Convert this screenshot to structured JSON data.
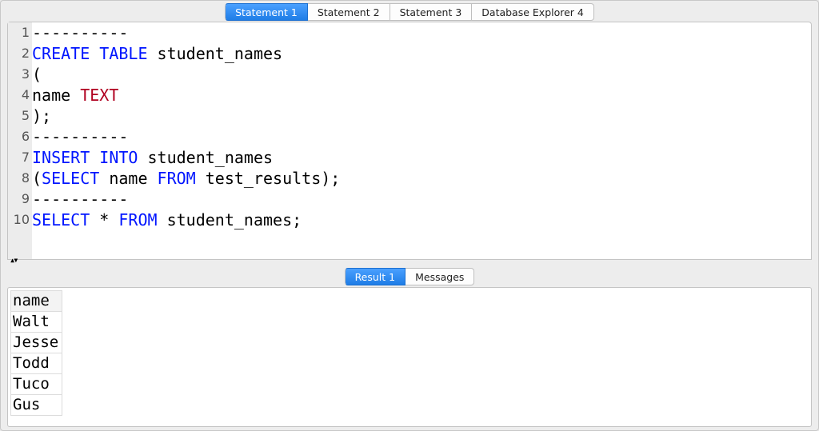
{
  "topTabs": [
    {
      "label": "Statement 1",
      "active": true
    },
    {
      "label": "Statement 2",
      "active": false
    },
    {
      "label": "Statement 3",
      "active": false
    },
    {
      "label": "Database Explorer 4",
      "active": false
    }
  ],
  "editor": {
    "lines": [
      [
        {
          "t": "txt",
          "v": "----------"
        }
      ],
      [
        {
          "t": "kw",
          "v": "CREATE"
        },
        {
          "t": "txt",
          "v": " "
        },
        {
          "t": "kw",
          "v": "TABLE"
        },
        {
          "t": "txt",
          "v": " student_names"
        }
      ],
      [
        {
          "t": "txt",
          "v": "("
        }
      ],
      [
        {
          "t": "txt",
          "v": "name "
        },
        {
          "t": "type",
          "v": "TEXT"
        }
      ],
      [
        {
          "t": "txt",
          "v": ");"
        }
      ],
      [
        {
          "t": "txt",
          "v": "----------"
        }
      ],
      [
        {
          "t": "kw",
          "v": "INSERT"
        },
        {
          "t": "txt",
          "v": " "
        },
        {
          "t": "kw",
          "v": "INTO"
        },
        {
          "t": "txt",
          "v": " student_names"
        }
      ],
      [
        {
          "t": "txt",
          "v": "("
        },
        {
          "t": "kw",
          "v": "SELECT"
        },
        {
          "t": "txt",
          "v": " name "
        },
        {
          "t": "kw",
          "v": "FROM"
        },
        {
          "t": "txt",
          "v": " test_results);"
        }
      ],
      [
        {
          "t": "txt",
          "v": "----------"
        }
      ],
      [
        {
          "t": "kw",
          "v": "SELECT"
        },
        {
          "t": "txt",
          "v": " * "
        },
        {
          "t": "kw",
          "v": "FROM"
        },
        {
          "t": "txt",
          "v": " student_names;"
        }
      ]
    ]
  },
  "resultTabs": [
    {
      "label": "Result 1",
      "active": true
    },
    {
      "label": "Messages",
      "active": false
    }
  ],
  "result": {
    "columns": [
      "name"
    ],
    "rows": [
      [
        "Walt"
      ],
      [
        "Jesse"
      ],
      [
        "Todd"
      ],
      [
        "Tuco"
      ],
      [
        "Gus"
      ]
    ]
  },
  "splitterGlyph": "▴▾"
}
